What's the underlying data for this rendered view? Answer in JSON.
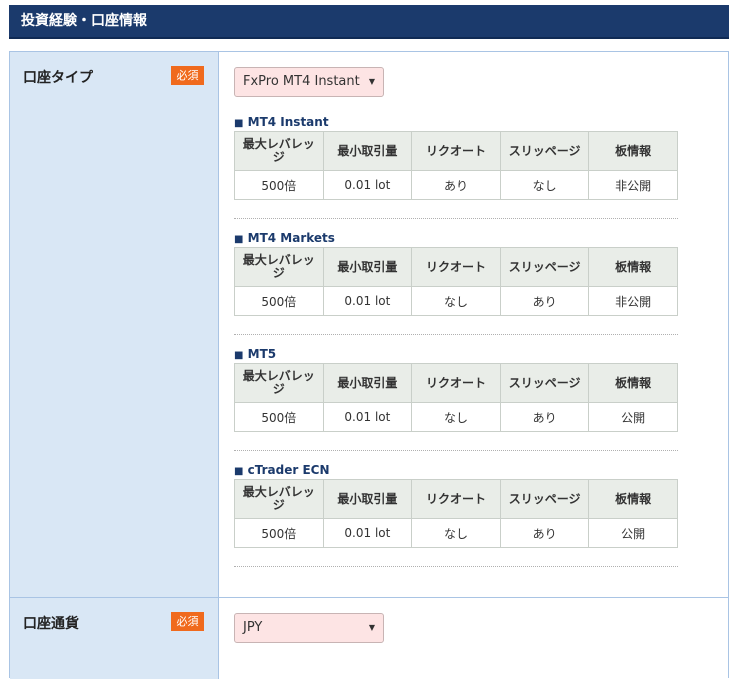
{
  "header": {
    "title": "投資経験・口座情報"
  },
  "account_type": {
    "label": "口座タイプ",
    "required": "必須",
    "select_value": "FxPro MT4 Instant",
    "columns": [
      "最大レバレッジ",
      "最小取引量",
      "リクオート",
      "スリッページ",
      "板情報"
    ],
    "plans": [
      {
        "name": "MT4 Instant",
        "values": [
          "500倍",
          "0.01 lot",
          "あり",
          "なし",
          "非公開"
        ]
      },
      {
        "name": "MT4 Markets",
        "values": [
          "500倍",
          "0.01 lot",
          "なし",
          "あり",
          "非公開"
        ]
      },
      {
        "name": "MT5",
        "values": [
          "500倍",
          "0.01 lot",
          "なし",
          "あり",
          "公開"
        ]
      },
      {
        "name": "cTrader ECN",
        "values": [
          "500倍",
          "0.01 lot",
          "なし",
          "あり",
          "公開"
        ]
      }
    ]
  },
  "currency": {
    "label": "口座通貨",
    "required": "必須",
    "select_value": "JPY"
  },
  "icons": {
    "bullet": "■",
    "select_arrow": "▼"
  },
  "colors": {
    "header_bg": "#1b3a6c",
    "badge": "#f06a1d",
    "label_bg": "#d9e7f5",
    "select_bg": "#fde4e4"
  }
}
